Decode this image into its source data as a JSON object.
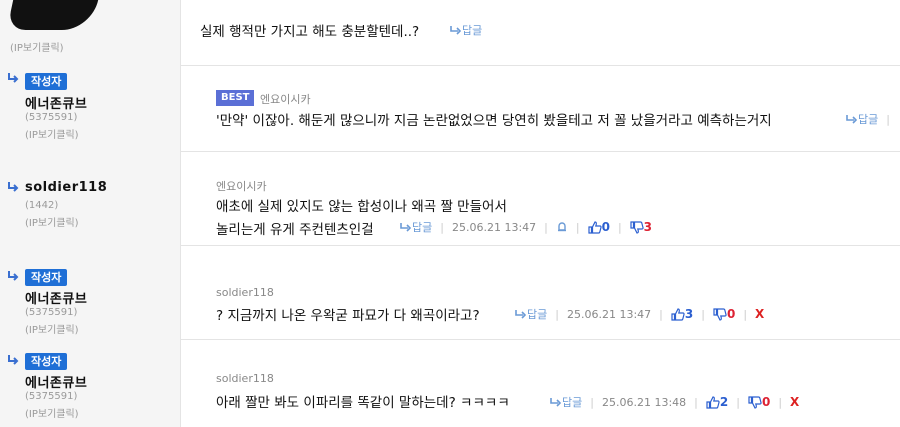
{
  "comments": [
    {
      "author": {
        "ip_label": "(IP보기클릭)"
      },
      "text": "실제 행적만 가지고 해도 충분할텐데..?",
      "reply_label": "답글"
    },
    {
      "author": {
        "badge": "작성자",
        "nick": "에너존큐브",
        "uid": "(5375591)",
        "ip_label": "(IP보기클릭)"
      },
      "best_label": "BEST",
      "parent": "엔요이시카",
      "text": "'만약' 이잖아. 해둔게 많으니까 지금 논란없었으면 당연히 봤을테고 저 꼴 났을거라고 예측하는거지",
      "reply_label": "답글"
    },
    {
      "author": {
        "nick": "soldier118",
        "uid": "(1442)",
        "ip_label": "(IP보기클릭)"
      },
      "parent": "엔요이시카",
      "text_line1": "애초에 실제 있지도 않는 합성이나 왜곡 짤 만들어서",
      "text_line2": "놀리는게 유게 주컨텐츠인걸",
      "reply_label": "답글",
      "time": "25.06.21 13:47",
      "up": "0",
      "down": "3"
    },
    {
      "author": {
        "badge": "작성자",
        "nick": "에너존큐브",
        "uid": "(5375591)",
        "ip_label": "(IP보기클릭)"
      },
      "parent": "soldier118",
      "text": "? 지금까지 나온 우왁굳 파묘가 다 왜곡이라고?",
      "reply_label": "답글",
      "time": "25.06.21 13:47",
      "up": "3",
      "down": "0",
      "delete": "X"
    },
    {
      "author": {
        "badge": "작성자",
        "nick": "에너존큐브",
        "uid": "(5375591)",
        "ip_label": "(IP보기클릭)"
      },
      "parent": "soldier118",
      "text": "아래 짤만 봐도 이파리를 똑같이 말하는데? ㅋㅋㅋㅋ",
      "reply_label": "답글",
      "time": "25.06.21 13:48",
      "up": "2",
      "down": "0",
      "delete": "X"
    }
  ]
}
